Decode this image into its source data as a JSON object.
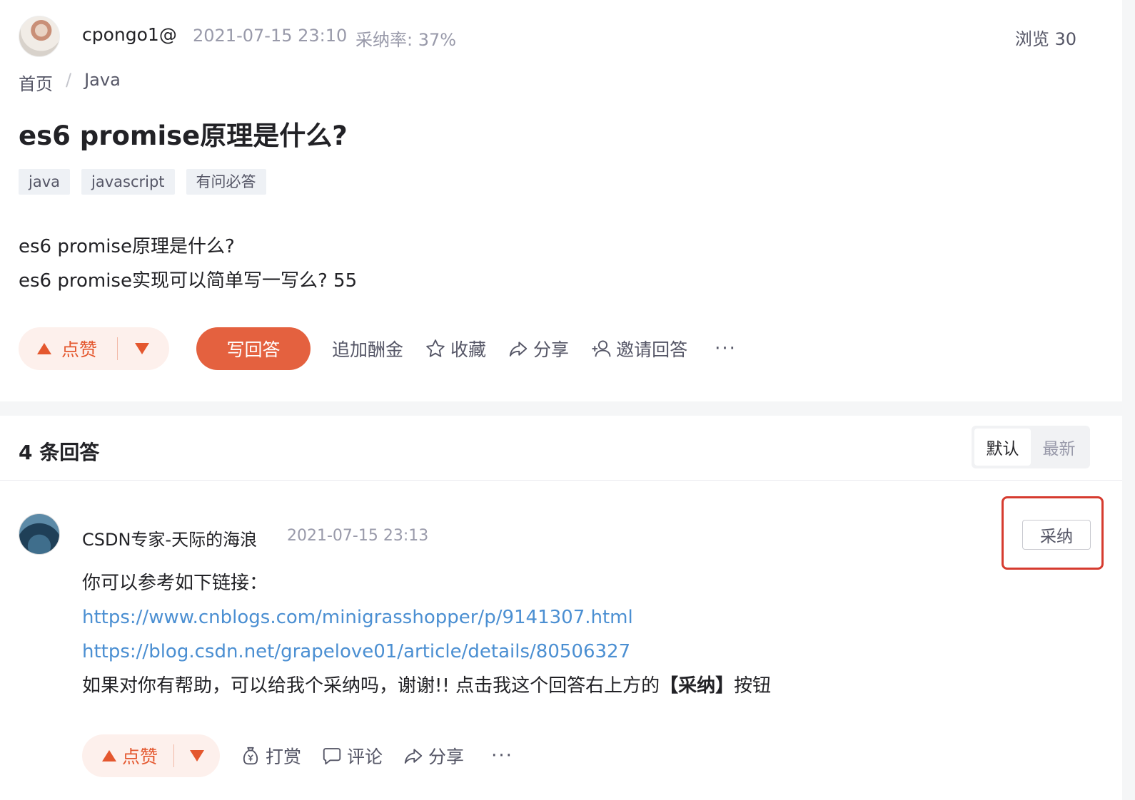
{
  "question": {
    "author": "cpongo1@",
    "time": "2021-07-15 23:10",
    "accept_rate": "采纳率: 37%",
    "views": "浏览 30",
    "breadcrumb": {
      "home": "首页",
      "sep": "/",
      "category": "Java"
    },
    "title": "es6 promise原理是什么?",
    "tags": [
      "java",
      "javascript",
      "有问必答"
    ],
    "body": [
      "es6 promise原理是什么?",
      "es6 promise实现可以简单写一写么?  55"
    ],
    "actions": {
      "like": "点赞",
      "write_answer": "写回答",
      "add_bounty": "追加酬金",
      "favorite": "收藏",
      "share": "分享",
      "invite": "邀请回答",
      "more": "···"
    }
  },
  "answers": {
    "count_label": "4 条回答",
    "sort": {
      "default": "默认",
      "latest": "最新"
    }
  },
  "answer": {
    "author": "CSDN专家-天际的海浪",
    "time": "2021-07-15 23:13",
    "accept_label": "采纳",
    "intro": "你可以参考如下链接：",
    "links": [
      "https://www.cnblogs.com/minigrasshopper/p/9141307.html",
      "https://blog.csdn.net/grapelove01/article/details/80506327"
    ],
    "closing_prefix": "如果对你有帮助，可以给我个采纳吗，谢谢!! 点击我这个回答右上方的",
    "closing_bold": "【采纳】",
    "closing_suffix": "按钮",
    "actions": {
      "like": "点赞",
      "reward": "打赏",
      "comment": "评论",
      "share": "分享",
      "more": "···"
    }
  },
  "colors": {
    "accent": "#e4613f",
    "link": "#4b8fd2",
    "highlight_box": "#d63b2f"
  }
}
